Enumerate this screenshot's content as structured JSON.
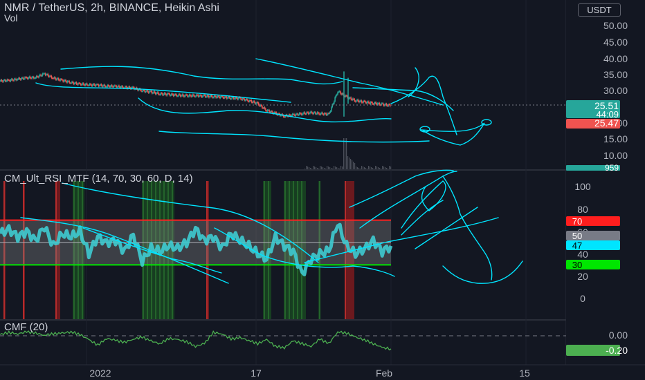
{
  "header": {
    "title": "NMR / TetherUS, 2h, BINANCE, Heikin Ashi",
    "vol_label": "Vol",
    "currency": "USDT"
  },
  "indicators": {
    "rsi_label": "CM_Ult_RSI_MTF (14, 70, 30, 60, D, 14)",
    "cmf_label": "CMF (20)"
  },
  "colors": {
    "background": "#131722",
    "up": "#26a69a",
    "down": "#ef5350",
    "drawing": "#00e5ff",
    "rsi_line": "#3ecbd0",
    "cmf_line": "#4caf50",
    "level_70": "#ff1e1e",
    "level_30": "#00e600",
    "red_zone": "#b71c1c",
    "green_zone": "#1b5e20"
  },
  "chart_data": [
    {
      "type": "candlestick",
      "title": "NMR / TetherUS, 2h, BINANCE, Heikin Ashi",
      "y_ticks": [
        "50.00",
        "45.00",
        "40.00",
        "35.00",
        "30.00",
        "20.00",
        "15.00",
        "10.00"
      ],
      "ylim": [
        8,
        55
      ],
      "x_ticks": [
        "2022",
        "17",
        "Feb",
        "15"
      ],
      "close_series": [
        33.0,
        33.2,
        33.6,
        34.0,
        34.1,
        35.3,
        33.9,
        33.2,
        32.5,
        32.0,
        31.8,
        31.7,
        31.4,
        31.3,
        31.0,
        30.8,
        30.0,
        29.5,
        29.0,
        28.8,
        28.6,
        28.4,
        28.5,
        28.3,
        28.2,
        28.0,
        27.8,
        27.6,
        27.0,
        26.0,
        24.0,
        23.0,
        22.2,
        22.5,
        23.0,
        23.2,
        23.0,
        22.7,
        29.8,
        28.0,
        27.0,
        26.5,
        26.2,
        25.8,
        25.5
      ],
      "price_labels": [
        {
          "text": "25.51",
          "color": "#26a69a"
        },
        {
          "text": "44:09",
          "color": "#26a69a"
        },
        {
          "text": "25.47",
          "color": "#ef5350"
        }
      ],
      "volume_label": "959"
    },
    {
      "type": "line",
      "title": "CM_Ult_RSI_MTF (14, 70, 30, 60, D, 14)",
      "y_ticks": [
        "100",
        "80",
        "60",
        "40",
        "20",
        "0"
      ],
      "ylim": [
        0,
        100
      ],
      "levels": [
        70,
        30
      ],
      "rsi_series": [
        58,
        62,
        55,
        60,
        52,
        64,
        47,
        58,
        55,
        60,
        40,
        55,
        50,
        52,
        42,
        57,
        33,
        45,
        42,
        47,
        45,
        50,
        62,
        52,
        55,
        45,
        58,
        52,
        47,
        40,
        35,
        55,
        47,
        42,
        22,
        35,
        40,
        43,
        67,
        47,
        40,
        44,
        52,
        42,
        47
      ],
      "value_labels": [
        {
          "text": "70",
          "color": "#ff1e1e"
        },
        {
          "text": "50",
          "color": "#787b86"
        },
        {
          "text": "47",
          "color": "#00e5ff"
        },
        {
          "text": "30",
          "color": "#00e600"
        }
      ]
    },
    {
      "type": "line",
      "title": "CMF (20)",
      "y_ticks": [
        "0.00"
      ],
      "cmf_series": [
        0.02,
        0.05,
        0.03,
        0.06,
        0.04,
        0.01,
        0.03,
        0.04,
        0.06,
        0.02,
        -0.06,
        -0.14,
        -0.04,
        -0.07,
        -0.1,
        -0.05,
        -0.02,
        -0.08,
        -0.12,
        -0.04,
        -0.06,
        -0.09,
        -0.16,
        -0.12,
        0.05,
        0.03,
        -0.05,
        -0.03,
        -0.07,
        -0.12,
        -0.06,
        -0.16,
        -0.18,
        -0.08,
        -0.12,
        -0.16,
        -0.05,
        -0.12,
        0.06,
        0.04,
        -0.02,
        -0.06,
        -0.12,
        -0.18,
        -0.2
      ],
      "value_labels": [
        {
          "text": "-0.20",
          "color": "#4caf50"
        }
      ]
    }
  ]
}
